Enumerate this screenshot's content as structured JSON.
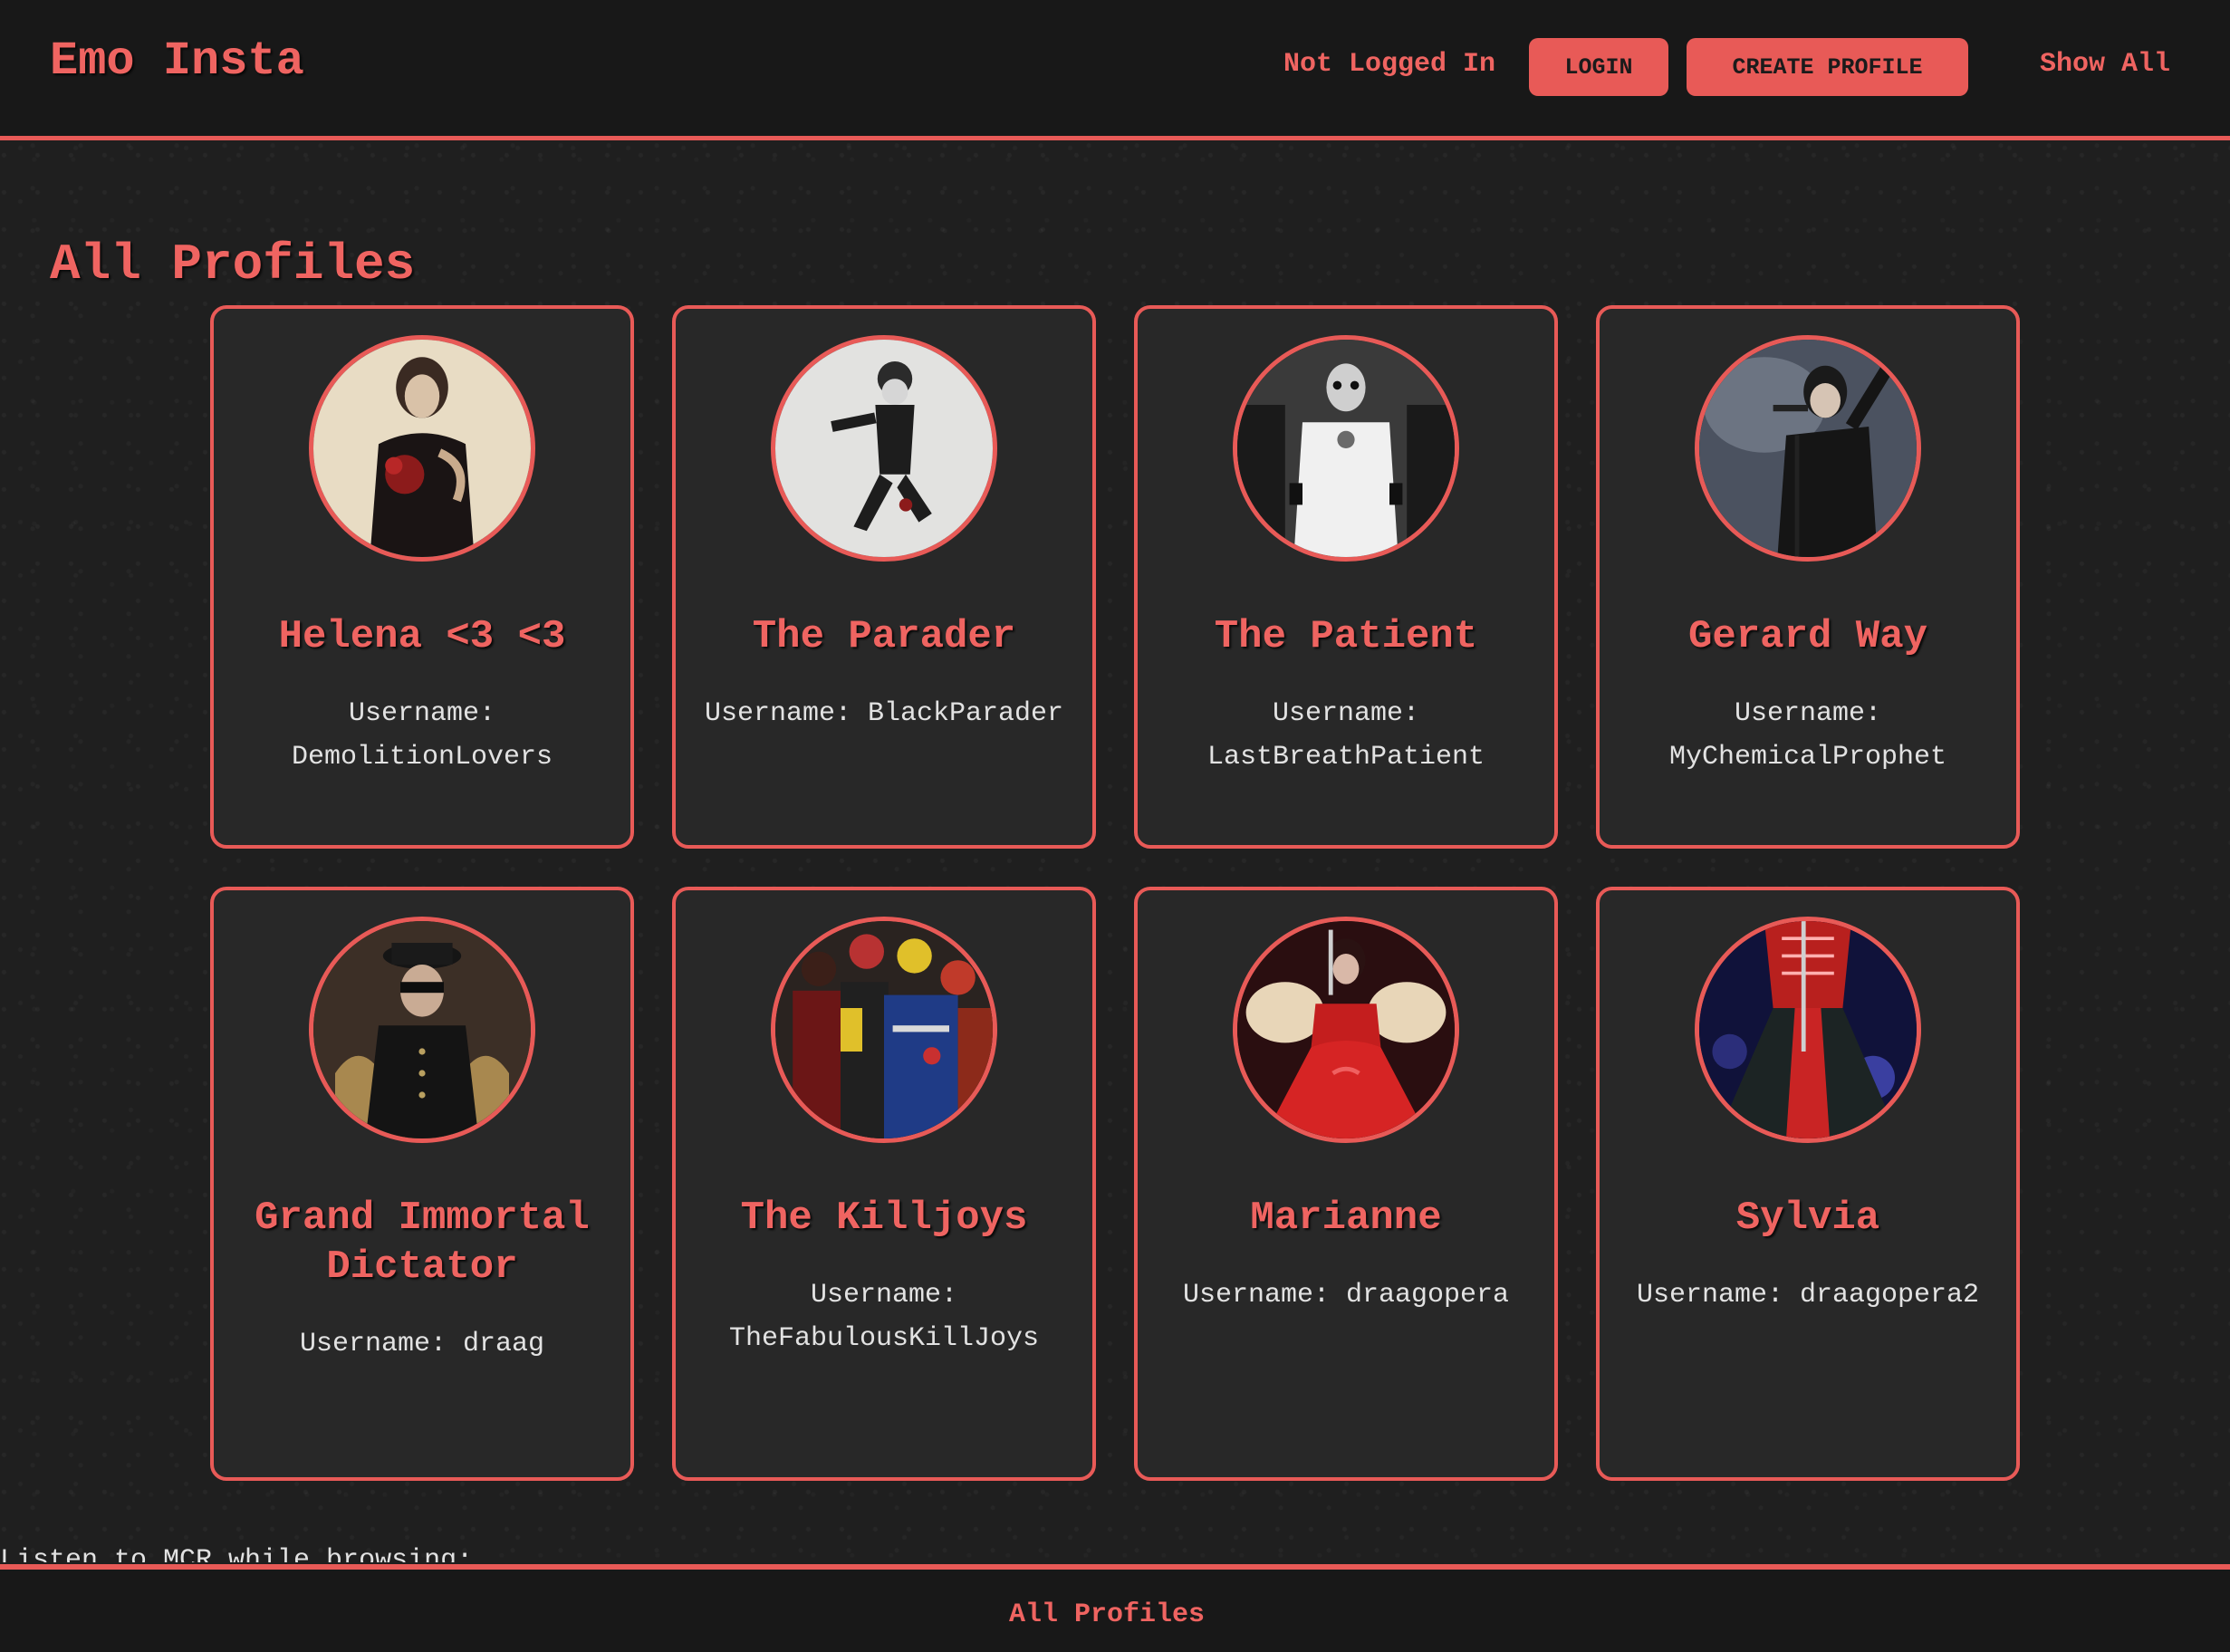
{
  "header": {
    "brand": "Emo Insta",
    "status": "Not Logged In",
    "login_label": "LOGIN",
    "create_label": "CREATE PROFILE",
    "show_all_label": "Show All"
  },
  "main": {
    "title": "All Profiles",
    "profiles": [
      {
        "name": "Helena <3 <3",
        "username": "Username: DemolitionLovers"
      },
      {
        "name": "The Parader",
        "username": "Username: BlackParader"
      },
      {
        "name": "The Patient",
        "username": "Username: LastBreathPatient"
      },
      {
        "name": "Gerard Way",
        "username": "Username: MyChemicalProphet"
      },
      {
        "name": "Grand Immortal Dictator",
        "username": "Username: draag"
      },
      {
        "name": "The Killjoys",
        "username": "Username: TheFabulousKillJoys"
      },
      {
        "name": "Marianne",
        "username": "Username: draagopera"
      },
      {
        "name": "Sylvia",
        "username": "Username: draagopera2"
      }
    ]
  },
  "listen_text": "Listen to MCR while browsing:",
  "footer": {
    "link_label": "All Profiles"
  },
  "colors": {
    "accent": "#e85a57",
    "background": "#1f1f1f",
    "card": "#282828",
    "header": "#181818"
  }
}
